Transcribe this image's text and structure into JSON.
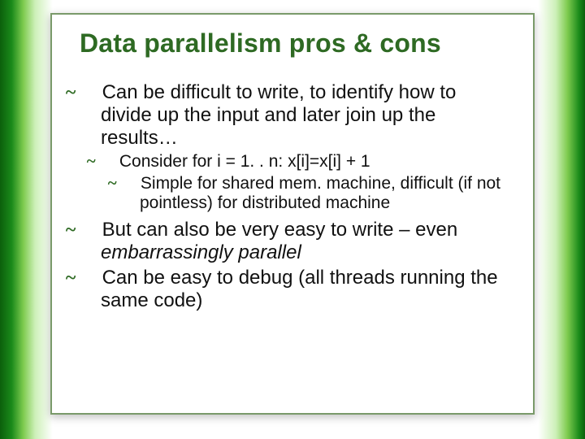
{
  "title": "Data parallelism pros & cons",
  "bullets": {
    "b1": "Can be difficult to write, to identify how to divide up the input and later join up the results…",
    "b1a": "Consider for i = 1. . n: x[i]=x[i] + 1",
    "b1a1": "Simple for shared mem. machine, difficult (if not pointless) for distributed machine",
    "b2_pre": "But can also be very easy to write – even ",
    "b2_em": "embarrassingly parallel",
    "b3": "Can be easy to debug (all threads running the same code)"
  }
}
